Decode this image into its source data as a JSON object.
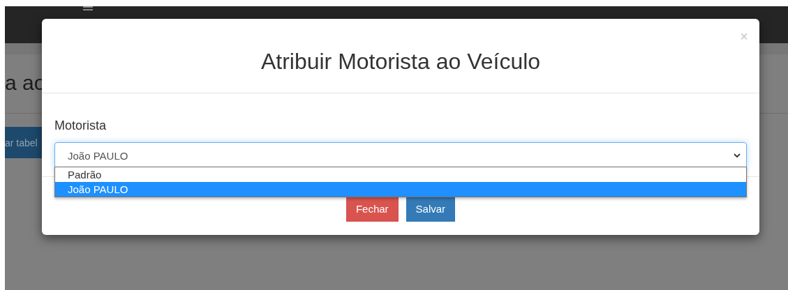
{
  "background_page": {
    "heading": "a ao",
    "button": "ar tabel"
  },
  "modal": {
    "title": "Atribuir Motorista ao Veículo",
    "close": "×",
    "field": {
      "label": "Motorista",
      "value": "João PAULO",
      "expanded": true,
      "options": [
        {
          "label": "Padrão",
          "selected": false
        },
        {
          "label": "João PAULO",
          "selected": true
        }
      ]
    },
    "buttons": [
      {
        "label": "Fechar",
        "kind": "danger"
      },
      {
        "label": "Salvar",
        "kind": "primary"
      }
    ]
  }
}
